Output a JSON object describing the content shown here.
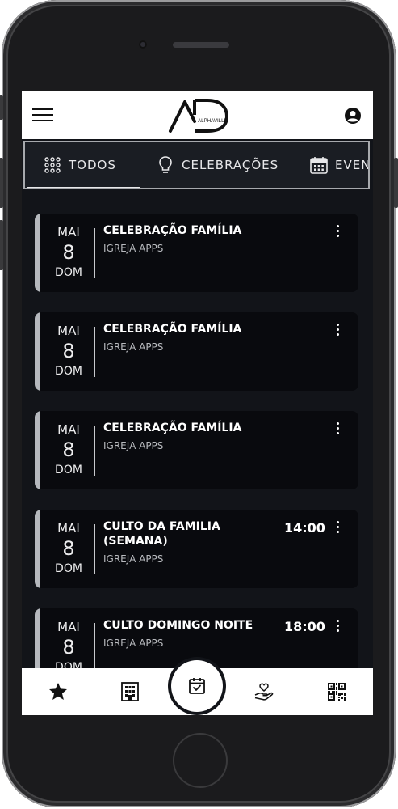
{
  "app": {
    "logo_text": "AD",
    "logo_subtext": "ALPHAVILLE"
  },
  "tabs": [
    {
      "label": "TODOS",
      "icon": "grid-dots-icon",
      "active": true
    },
    {
      "label": "CELEBRAÇÕES",
      "icon": "lightbulb-icon",
      "active": false
    },
    {
      "label": "EVEN",
      "icon": "calendar-icon",
      "active": false
    }
  ],
  "events": [
    {
      "month": "MAI",
      "day": "8",
      "weekday": "DOM",
      "title": "CELEBRAÇÃO FAMÍLIA",
      "org": "IGREJA APPS",
      "time": ""
    },
    {
      "month": "MAI",
      "day": "8",
      "weekday": "DOM",
      "title": "CELEBRAÇÃO FAMÍLIA",
      "org": "IGREJA APPS",
      "time": ""
    },
    {
      "month": "MAI",
      "day": "8",
      "weekday": "DOM",
      "title": "CELEBRAÇÃO FAMÍLIA",
      "org": "IGREJA APPS",
      "time": ""
    },
    {
      "month": "MAI",
      "day": "8",
      "weekday": "DOM",
      "title": "CULTO DA FAMILIA (SEMANA)",
      "org": "IGREJA APPS",
      "time": "14:00"
    },
    {
      "month": "MAI",
      "day": "8",
      "weekday": "DOM",
      "title": "CULTO DOMINGO NOITE",
      "org": "IGREJA APPS",
      "time": "18:00"
    }
  ],
  "bottom_nav": [
    {
      "icon": "star-icon"
    },
    {
      "icon": "building-icon"
    },
    {
      "icon": "calendar-check-icon",
      "active": true
    },
    {
      "icon": "hand-heart-icon"
    },
    {
      "icon": "qr-code-icon"
    }
  ],
  "colors": {
    "screen_bg": "#121419",
    "card_bg": "#090a0e",
    "accent": "#b5b8bd"
  }
}
